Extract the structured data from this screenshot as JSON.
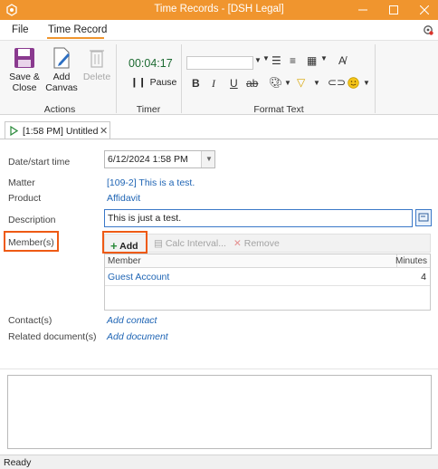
{
  "window": {
    "title": "Time Records - [DSH Legal]",
    "accent_color": "#f0952e"
  },
  "menu": {
    "file": "File",
    "time_record": "Time Record"
  },
  "ribbon": {
    "actions": {
      "save_close": [
        "Save &",
        "Close"
      ],
      "add_canvas": [
        "Add",
        "Canvas"
      ],
      "delete": "Delete",
      "group_label": "Actions"
    },
    "timer": {
      "value": "00:04:17",
      "pause": "Pause",
      "group_label": "Timer"
    },
    "format_text": {
      "group_label": "Format Text",
      "bold": "B",
      "italic": "I",
      "underline": "U"
    }
  },
  "doc_tab": {
    "label": "[1:58 PM] Untitled"
  },
  "form": {
    "date_label": "Date/start time",
    "date_value": "6/12/2024 1:58 PM",
    "matter_label": "Matter",
    "matter_value": "[109-2] This is a test.",
    "product_label": "Product",
    "product_value": "Affidavit",
    "description_label": "Description",
    "description_value": "This is just a test.",
    "members_label": "Member(s)",
    "contacts_label": "Contact(s)",
    "contacts_action": "Add contact",
    "related_label": "Related document(s)",
    "related_action": "Add document"
  },
  "members": {
    "toolbar": {
      "add": "Add",
      "calc": "Calc Interval...",
      "remove": "Remove"
    },
    "columns": [
      "Member",
      "Minutes"
    ],
    "rows": [
      {
        "member": "Guest Account",
        "minutes": "4"
      }
    ]
  },
  "status": {
    "text": "Ready"
  },
  "highlight_color": "#ee5a14"
}
